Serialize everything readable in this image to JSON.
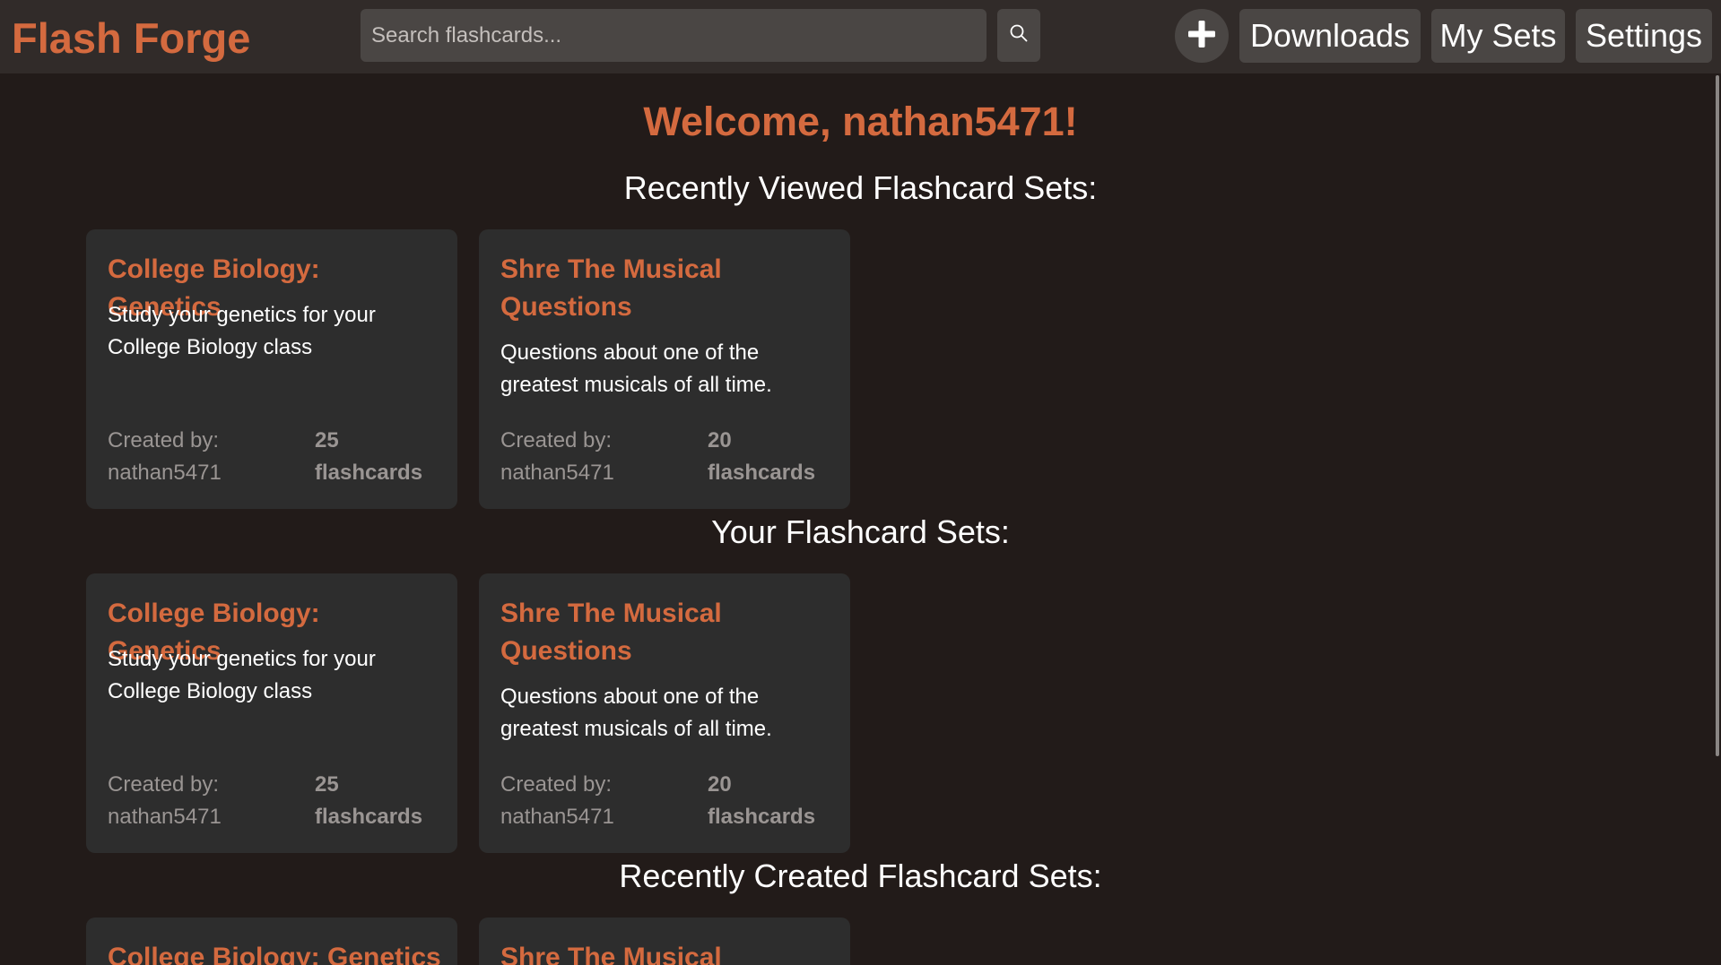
{
  "header": {
    "brand": "Flash Forge",
    "search": {
      "placeholder": "Search flashcards...",
      "value": ""
    },
    "nav": {
      "downloads": "Downloads",
      "my_sets": "My Sets",
      "settings": "Settings"
    }
  },
  "icons": {
    "search": "search-icon",
    "add": "plus-icon"
  },
  "colors": {
    "accent": "#d46a3f",
    "background": "#221b19",
    "header": "#312b29",
    "card": "#2d2d2d",
    "button": "#4a4644"
  },
  "main": {
    "welcome": "Welcome, nathan5471!",
    "sections": [
      {
        "title": "Recently Viewed Flashcard Sets:",
        "cards": [
          {
            "title": "College Biology: Genetics",
            "description": "Study your genetics for your College Biology class",
            "created_by_label": "Created by:",
            "creator": "nathan5471",
            "count": "25",
            "count_label": "flashcards"
          },
          {
            "title": "Shre The Musical Questions",
            "description": "Questions about one of the greatest musicals of all time.",
            "created_by_label": "Created by:",
            "creator": "nathan5471",
            "count": "20",
            "count_label": "flashcards"
          }
        ]
      },
      {
        "title": "Your Flashcard Sets:",
        "cards": [
          {
            "title": "College Biology: Genetics",
            "description": "Study your genetics for your College Biology class",
            "created_by_label": "Created by:",
            "creator": "nathan5471",
            "count": "25",
            "count_label": "flashcards"
          },
          {
            "title": "Shre The Musical Questions",
            "description": "Questions about one of the greatest musicals of all time.",
            "created_by_label": "Created by:",
            "creator": "nathan5471",
            "count": "20",
            "count_label": "flashcards"
          }
        ]
      },
      {
        "title": "Recently Created Flashcard Sets:",
        "cards": [
          {
            "title": "College Biology: Genetics"
          },
          {
            "title": "Shre The Musical"
          }
        ]
      }
    ]
  }
}
